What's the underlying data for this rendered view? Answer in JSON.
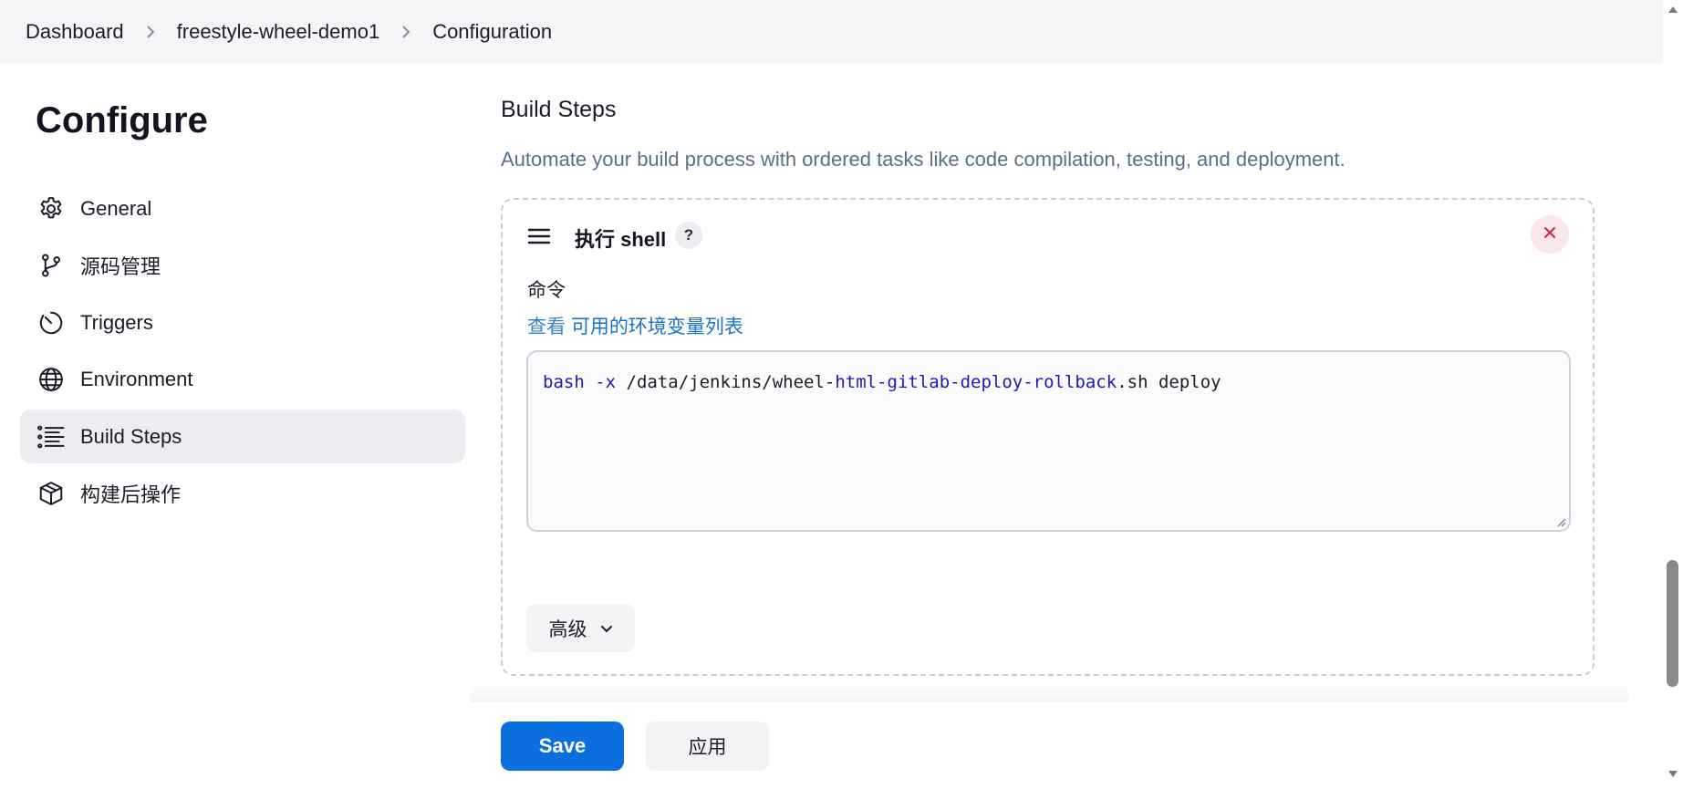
{
  "breadcrumb": {
    "items": [
      "Dashboard",
      "freestyle-wheel-demo1",
      "Configuration"
    ]
  },
  "sidebar": {
    "title": "Configure",
    "items": [
      {
        "label": "General",
        "icon": "gear-icon"
      },
      {
        "label": "源码管理",
        "icon": "git-branch-icon"
      },
      {
        "label": "Triggers",
        "icon": "clock-icon"
      },
      {
        "label": "Environment",
        "icon": "globe-icon"
      },
      {
        "label": "Build Steps",
        "icon": "list-icon",
        "active": true
      },
      {
        "label": "构建后操作",
        "icon": "package-icon"
      }
    ]
  },
  "main": {
    "section_title": "Build Steps",
    "section_description": "Automate your build process with ordered tasks like code compilation, testing, and deployment.",
    "step": {
      "title": "执行 shell",
      "help_label": "?",
      "command_label": "命令",
      "env_prefix": "查看",
      "env_link": "可用的环境变量列表",
      "command_parts": {
        "p1": "bash",
        "p2": " ",
        "p3": "-x",
        "p4": " /data/jenkins/wheel-",
        "p5": "html-gitlab-deploy-rollback",
        "p6": ".sh deploy"
      },
      "advanced_label": "高级"
    }
  },
  "footer": {
    "save_label": "Save",
    "apply_label": "应用"
  },
  "colors": {
    "primary": "#0b6fe0",
    "active_item_bg": "#ebedf0",
    "link": "#1a73c9",
    "danger": "#d61f3a"
  }
}
